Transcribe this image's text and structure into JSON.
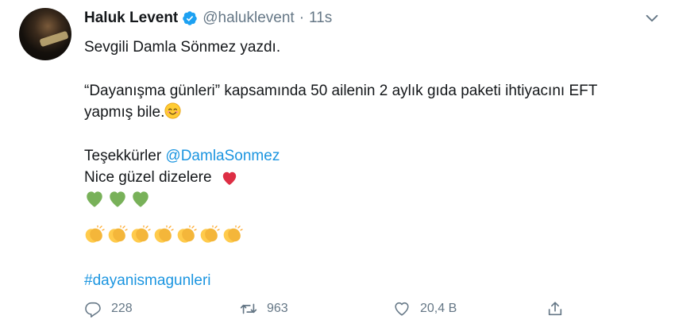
{
  "tweet": {
    "author_name": "Haluk Levent",
    "author_handle": "@haluklevent",
    "separator": "·",
    "time": "11s",
    "text": {
      "line1": "Sevgili Damla Sönmez yazdı.",
      "line2": "“Dayanışma günleri” kapsamında 50 ailenin 2 aylık gıda paketi ihtiyacını EFT",
      "line3": "yapmış bile.",
      "line4_prefix": "Teşekkürler ",
      "mention": "@DamlaSonmez",
      "line5": "Nice güzel dizelere",
      "hashtag": "#dayanismagunleri"
    },
    "emojis": {
      "smile": "smiling-face-with-smiling-eyes",
      "heart": "red-heart",
      "green_hearts": [
        "green-heart",
        "green-heart",
        "green-heart"
      ],
      "clapping": [
        "clapping-hands",
        "clapping-hands",
        "clapping-hands",
        "clapping-hands",
        "clapping-hands",
        "clapping-hands",
        "clapping-hands"
      ]
    },
    "actions": {
      "reply_count": "228",
      "retweet_count": "963",
      "like_count": "20,4 B"
    }
  },
  "colors": {
    "link": "#1b95e0",
    "muted": "#657786",
    "verified": "#1da1f2",
    "text": "#14171a"
  }
}
